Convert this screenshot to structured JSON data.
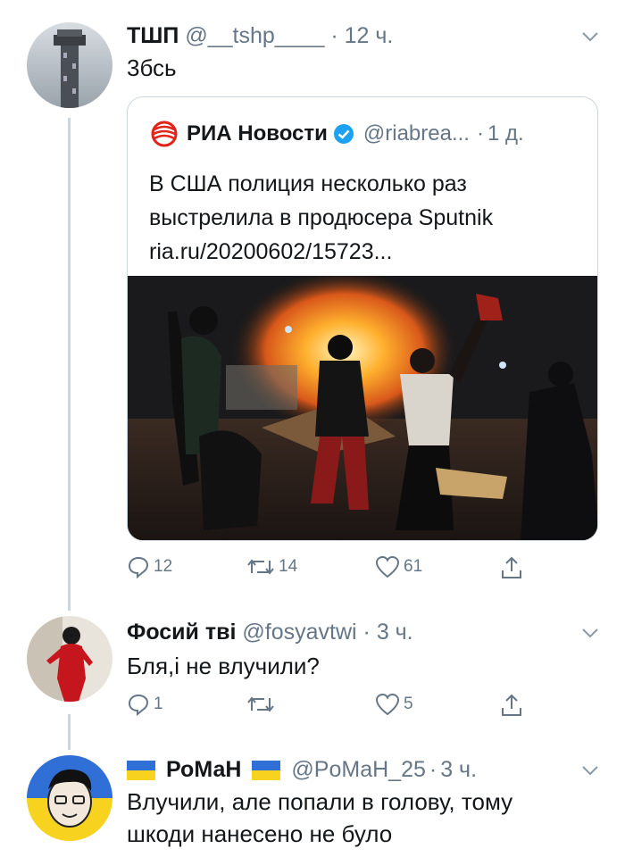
{
  "tweet1": {
    "name": "ТШП",
    "handle": "@__tshp____",
    "time": "12 ч.",
    "text": "3бсь",
    "quote": {
      "name": "РИА Новости",
      "handle": "@riabrea...",
      "time": "1 д.",
      "line1": "В США полиция несколько раз",
      "line2": "выстрелила в продюсера Sputnik",
      "line3": "ria.ru/20200602/15723..."
    },
    "replies": "12",
    "retweets": "14",
    "likes": "61"
  },
  "tweet2": {
    "name": "Фосий тві",
    "handle": "@fosyavtwi",
    "time": "3 ч.",
    "text": "Бля,і не влучили?",
    "replies": "1",
    "retweets": "",
    "likes": "5"
  },
  "tweet3": {
    "name": "РоМаН",
    "handle": "@PoMaH_25",
    "time": "3 ч.",
    "line1": "Влучили, але попали в голову, тому",
    "line2": "шкоди нанесено не було"
  },
  "separator": "·",
  "colors": {
    "text": "#14171a",
    "muted": "#657786",
    "verified": "#1da1f2",
    "border": "#ccd6dd",
    "ria_red": "#e2231a"
  }
}
